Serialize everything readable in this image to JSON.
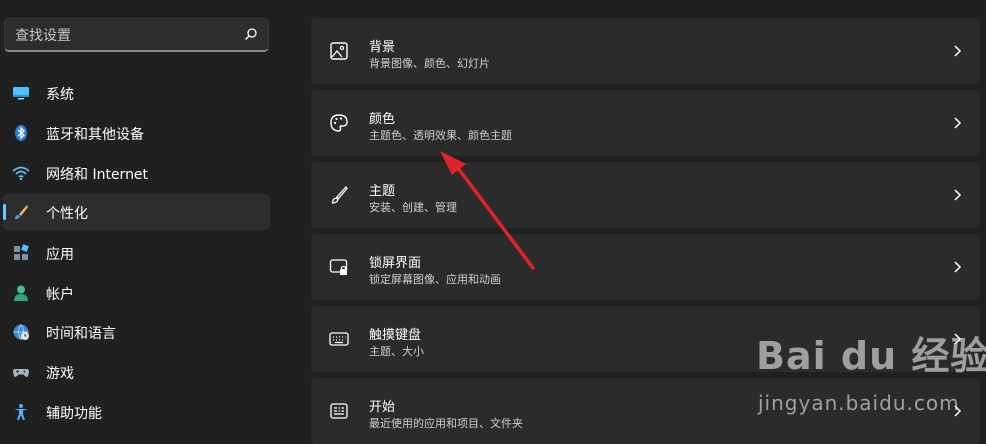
{
  "search": {
    "placeholder": "查找设置",
    "icon": "search-icon"
  },
  "sidebar": {
    "items": [
      {
        "label": "系统",
        "icon": "monitor-icon",
        "active": false
      },
      {
        "label": "蓝牙和其他设备",
        "icon": "bluetooth-icon",
        "active": false
      },
      {
        "label": "网络和 Internet",
        "icon": "wifi-icon",
        "active": false
      },
      {
        "label": "个性化",
        "icon": "brush-icon",
        "active": true
      },
      {
        "label": "应用",
        "icon": "apps-icon",
        "active": false
      },
      {
        "label": "帐户",
        "icon": "person-icon",
        "active": false
      },
      {
        "label": "时间和语言",
        "icon": "globe-clock-icon",
        "active": false
      },
      {
        "label": "游戏",
        "icon": "gamepad-icon",
        "active": false
      },
      {
        "label": "辅助功能",
        "icon": "accessibility-icon",
        "active": false
      }
    ]
  },
  "cards": [
    {
      "title": "背景",
      "subtitle": "背景图像、颜色、幻灯片",
      "icon": "picture-icon"
    },
    {
      "title": "颜色",
      "subtitle": "主题色、透明效果、颜色主题",
      "icon": "palette-icon"
    },
    {
      "title": "主题",
      "subtitle": "安装、创建、管理",
      "icon": "brush-icon"
    },
    {
      "title": "锁屏界面",
      "subtitle": "锁定屏幕图像、应用和动画",
      "icon": "lockscreen-icon"
    },
    {
      "title": "触摸键盘",
      "subtitle": "主题、大小",
      "icon": "keyboard-icon"
    },
    {
      "title": "开始",
      "subtitle": "最近使用的应用和项目、文件夹",
      "icon": "start-icon"
    }
  ],
  "watermark": {
    "logo": "Bai du 经验",
    "url": "jingyan.baidu.com"
  },
  "colors": {
    "background": "#202020",
    "card": "#2b2b2b",
    "accent": "#60cdff",
    "arrow": "#e0242c"
  }
}
